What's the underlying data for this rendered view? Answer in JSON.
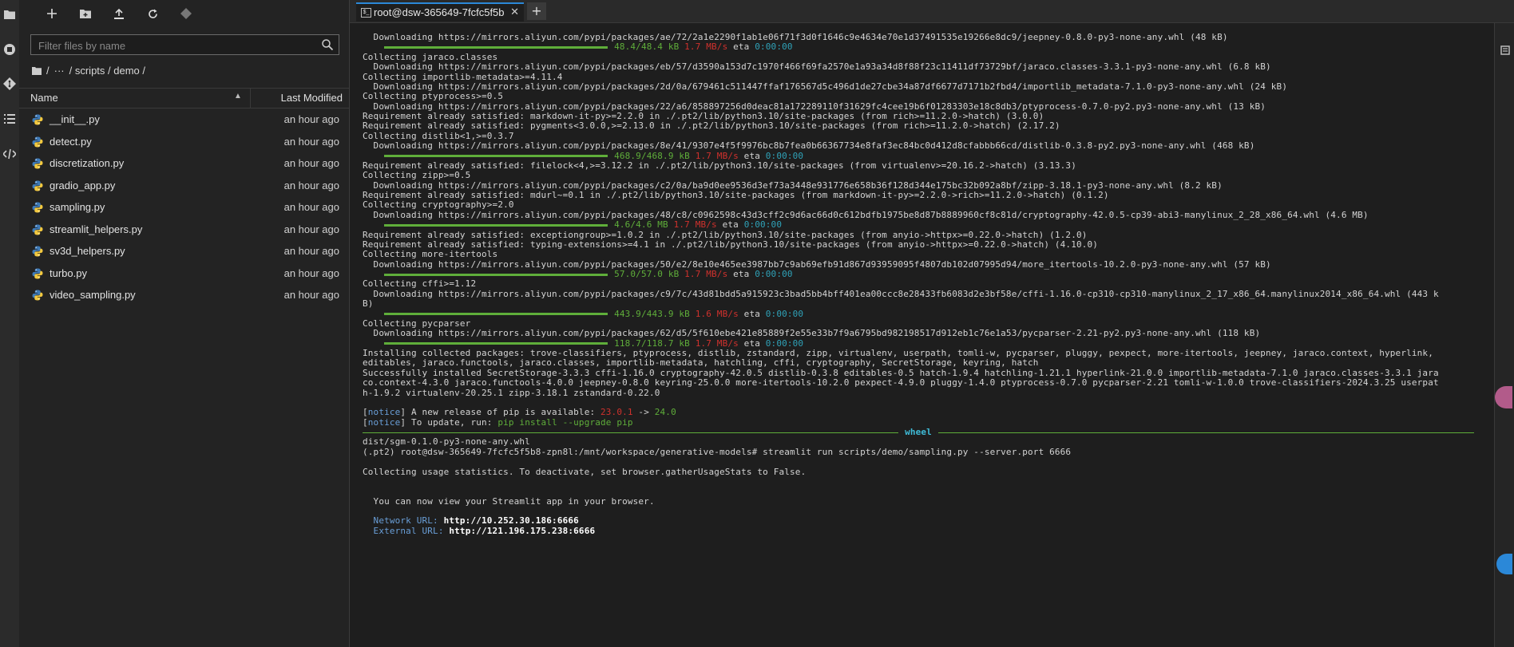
{
  "sidebar": {
    "filter_placeholder": "Filter files by name",
    "breadcrumb": {
      "root": "/",
      "ellipsis": "···",
      "sep": "/",
      "path": "/ scripts / demo /"
    },
    "columns": {
      "name": "Name",
      "modified": "Last Modified"
    },
    "files": [
      {
        "name": "__init__.py",
        "modified": "an hour ago"
      },
      {
        "name": "detect.py",
        "modified": "an hour ago"
      },
      {
        "name": "discretization.py",
        "modified": "an hour ago"
      },
      {
        "name": "gradio_app.py",
        "modified": "an hour ago"
      },
      {
        "name": "sampling.py",
        "modified": "an hour ago"
      },
      {
        "name": "streamlit_helpers.py",
        "modified": "an hour ago"
      },
      {
        "name": "sv3d_helpers.py",
        "modified": "an hour ago"
      },
      {
        "name": "turbo.py",
        "modified": "an hour ago"
      },
      {
        "name": "video_sampling.py",
        "modified": "an hour ago"
      }
    ]
  },
  "tabs": {
    "terminal_label": "root@dsw-365649-7fcfc5f5b",
    "close": "✕",
    "add": "+"
  },
  "terminal": {
    "l0": "  Downloading https://mirrors.aliyun.com/pypi/packages/ae/72/2a1e2290f1ab1e06f71f3d0f1646c9e4634e70e1d37491535e19266e8dc9/jeepney-0.8.0-py3-none-any.whl (48 kB)",
    "p1": {
      "done": "48.4/48.4 kB",
      "speed": "1.7 MB/s",
      "eta": "eta",
      "time": "0:00:00"
    },
    "l2": "Collecting jaraco.classes",
    "l3": "  Downloading https://mirrors.aliyun.com/pypi/packages/eb/57/d3590a153d7c1970f466f69fa2570e1a93a34d8f88f23c11411df73729bf/jaraco.classes-3.3.1-py3-none-any.whl (6.8 kB)",
    "l4": "Collecting importlib-metadata>=4.11.4",
    "l5": "  Downloading https://mirrors.aliyun.com/pypi/packages/2d/0a/679461c511447ffaf176567d5c496d1de27cbe34a87df6677d7171b2fbd4/importlib_metadata-7.1.0-py3-none-any.whl (24 kB)",
    "l6": "Collecting ptyprocess>=0.5",
    "l7": "  Downloading https://mirrors.aliyun.com/pypi/packages/22/a6/858897256d0deac81a172289110f31629fc4cee19b6f01283303e18c8db3/ptyprocess-0.7.0-py2.py3-none-any.whl (13 kB)",
    "l8": "Requirement already satisfied: markdown-it-py>=2.2.0 in ./.pt2/lib/python3.10/site-packages (from rich>=11.2.0->hatch) (3.0.0)",
    "l9": "Requirement already satisfied: pygments<3.0.0,>=2.13.0 in ./.pt2/lib/python3.10/site-packages (from rich>=11.2.0->hatch) (2.17.2)",
    "l10": "Collecting distlib<1,>=0.3.7",
    "l11": "  Downloading https://mirrors.aliyun.com/pypi/packages/8e/41/9307e4f5f9976bc8b7fea0b66367734e8faf3ec84bc0d412d8cfabbb66cd/distlib-0.3.8-py2.py3-none-any.whl (468 kB)",
    "p12": {
      "done": "468.9/468.9 kB",
      "speed": "1.7 MB/s",
      "eta": "eta",
      "time": "0:00:00"
    },
    "l13": "Requirement already satisfied: filelock<4,>=3.12.2 in ./.pt2/lib/python3.10/site-packages (from virtualenv>=20.16.2->hatch) (3.13.3)",
    "l14": "Collecting zipp>=0.5",
    "l15": "  Downloading https://mirrors.aliyun.com/pypi/packages/c2/0a/ba9d0ee9536d3ef73a3448e931776e658b36f128d344e175bc32b092a8bf/zipp-3.18.1-py3-none-any.whl (8.2 kB)",
    "l16": "Requirement already satisfied: mdurl~=0.1 in ./.pt2/lib/python3.10/site-packages (from markdown-it-py>=2.2.0->rich>=11.2.0->hatch) (0.1.2)",
    "l17": "Collecting cryptography>=2.0",
    "l18": "  Downloading https://mirrors.aliyun.com/pypi/packages/48/c8/c0962598c43d3cff2c9d6ac66d0c612bdfb1975be8d87b8889960cf8c81d/cryptography-42.0.5-cp39-abi3-manylinux_2_28_x86_64.whl (4.6 MB)",
    "p19": {
      "done": "4.6/4.6 MB",
      "speed": "1.7 MB/s",
      "eta": "eta",
      "time": "0:00:00"
    },
    "l20": "Requirement already satisfied: exceptiongroup>=1.0.2 in ./.pt2/lib/python3.10/site-packages (from anyio->httpx>=0.22.0->hatch) (1.2.0)",
    "l21": "Requirement already satisfied: typing-extensions>=4.1 in ./.pt2/lib/python3.10/site-packages (from anyio->httpx>=0.22.0->hatch) (4.10.0)",
    "l22": "Collecting more-itertools",
    "l23": "  Downloading https://mirrors.aliyun.com/pypi/packages/50/e2/8e10e465ee3987bb7c9ab69efb91d867d93959095f4807db102d07995d94/more_itertools-10.2.0-py3-none-any.whl (57 kB)",
    "p24": {
      "done": "57.0/57.0 kB",
      "speed": "1.7 MB/s",
      "eta": "eta",
      "time": "0:00:00"
    },
    "l25": "Collecting cffi>=1.12",
    "l26": "  Downloading https://mirrors.aliyun.com/pypi/packages/c9/7c/43d81bdd5a915923c3bad5bb4bff401ea00ccc8e28433fb6083d2e3bf58e/cffi-1.16.0-cp310-cp310-manylinux_2_17_x86_64.manylinux2014_x86_64.whl (443 k",
    "l27": "B)",
    "p28": {
      "done": "443.9/443.9 kB",
      "speed": "1.6 MB/s",
      "eta": "eta",
      "time": "0:00:00"
    },
    "l29": "Collecting pycparser",
    "l30": "  Downloading https://mirrors.aliyun.com/pypi/packages/62/d5/5f610ebe421e85889f2e55e33b7f9a6795bd982198517d912eb1c76e1a53/pycparser-2.21-py2.py3-none-any.whl (118 kB)",
    "p31": {
      "done": "118.7/118.7 kB",
      "speed": "1.7 MB/s",
      "eta": "eta",
      "time": "0:00:00"
    },
    "l32": "Installing collected packages: trove-classifiers, ptyprocess, distlib, zstandard, zipp, virtualenv, userpath, tomli-w, pycparser, pluggy, pexpect, more-itertools, jeepney, jaraco.context, hyperlink,",
    "l33": "editables, jaraco.functools, jaraco.classes, importlib-metadata, hatchling, cffi, cryptography, SecretStorage, keyring, hatch",
    "l34": "Successfully installed SecretStorage-3.3.3 cffi-1.16.0 cryptography-42.0.5 distlib-0.3.8 editables-0.5 hatch-1.9.4 hatchling-1.21.1 hyperlink-21.0.0 importlib-metadata-7.1.0 jaraco.classes-3.3.1 jara",
    "l35": "co.context-4.3.0 jaraco.functools-4.0.0 jeepney-0.8.0 keyring-25.0.0 more-itertools-10.2.0 pexpect-4.9.0 pluggy-1.4.0 ptyprocess-0.7.0 pycparser-2.21 tomli-w-1.0.0 trove-classifiers-2024.3.25 userpat",
    "l36": "h-1.9.2 virtualenv-20.25.1 zipp-3.18.1 zstandard-0.22.0",
    "n38": {
      "tag": "notice",
      "text": " A new release of pip is available: ",
      "old": "23.0.1",
      "arrow": " -> ",
      "new": "24.0"
    },
    "n39": {
      "tag": "notice",
      "text": " To update, run: ",
      "cmd": "pip install --upgrade pip"
    },
    "wheel": "wheel",
    "l41": "dist/sgm-0.1.0-py3-none-any.whl",
    "l42": "(.pt2) root@dsw-365649-7fcfc5f5b8-zpn8l:/mnt/workspace/generative-models# streamlit run scripts/demo/sampling.py --server.port 6666",
    "l44": "Collecting usage statistics. To deactivate, set browser.gatherUsageStats to False.",
    "l47": "  You can now view your Streamlit app in your browser.",
    "u49": {
      "label": "  Network URL: ",
      "url": "http://10.252.30.186:6666"
    },
    "u50": {
      "label": "  External URL: ",
      "url": "http://121.196.175.238:6666"
    }
  }
}
